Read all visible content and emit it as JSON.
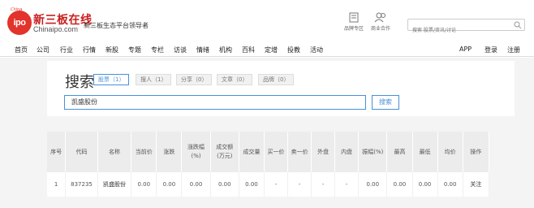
{
  "header": {
    "logo_small": "China",
    "logo_mark": "ipo",
    "logo_title": "新三板在线",
    "logo_domain": "Chinaipo.com",
    "slogan": "新三板生态平台领导者",
    "icons": [
      {
        "label": "品牌专区",
        "icon": "building-icon"
      },
      {
        "label": "商业合作",
        "icon": "people-icon"
      }
    ],
    "search_placeholder": "搜索 股票/资讯/讨论"
  },
  "nav": {
    "left": [
      "首页",
      "公司",
      "行业",
      "行情",
      "新股",
      "专题",
      "专栏",
      "访谈",
      "情绪",
      "机构",
      "百科",
      "定增",
      "投教",
      "活动"
    ],
    "right": [
      "APP",
      "登录",
      "注册"
    ]
  },
  "search": {
    "title": "搜索",
    "tabs": [
      {
        "label": "股票（1）",
        "active": true
      },
      {
        "label": "搜人（1）",
        "active": false
      },
      {
        "label": "分享（0）",
        "active": false
      },
      {
        "label": "文章（0）",
        "active": false
      },
      {
        "label": "品牌（0）",
        "active": false
      }
    ],
    "query": "凯盛股份",
    "button": "搜索"
  },
  "table": {
    "headers": [
      "序号",
      "代码",
      "名称",
      "当前价",
      "涨跌",
      "涨跌幅(%)",
      "成交额(万元)",
      "成交量",
      "买一价",
      "卖一价",
      "外盘",
      "内盘",
      "振幅(%)",
      "最高",
      "最低",
      "均价",
      "操作"
    ],
    "rows": [
      [
        "1",
        "837235",
        "凯盛股份",
        "0.00",
        "0.00",
        "0.00",
        "0.00",
        "0.00",
        "-",
        "-",
        "-",
        "-",
        "0.00",
        "0.00",
        "0.00",
        "0.00",
        "关注"
      ]
    ]
  },
  "colors": {
    "brand": "#e2332c",
    "accent": "#4a90d9"
  }
}
